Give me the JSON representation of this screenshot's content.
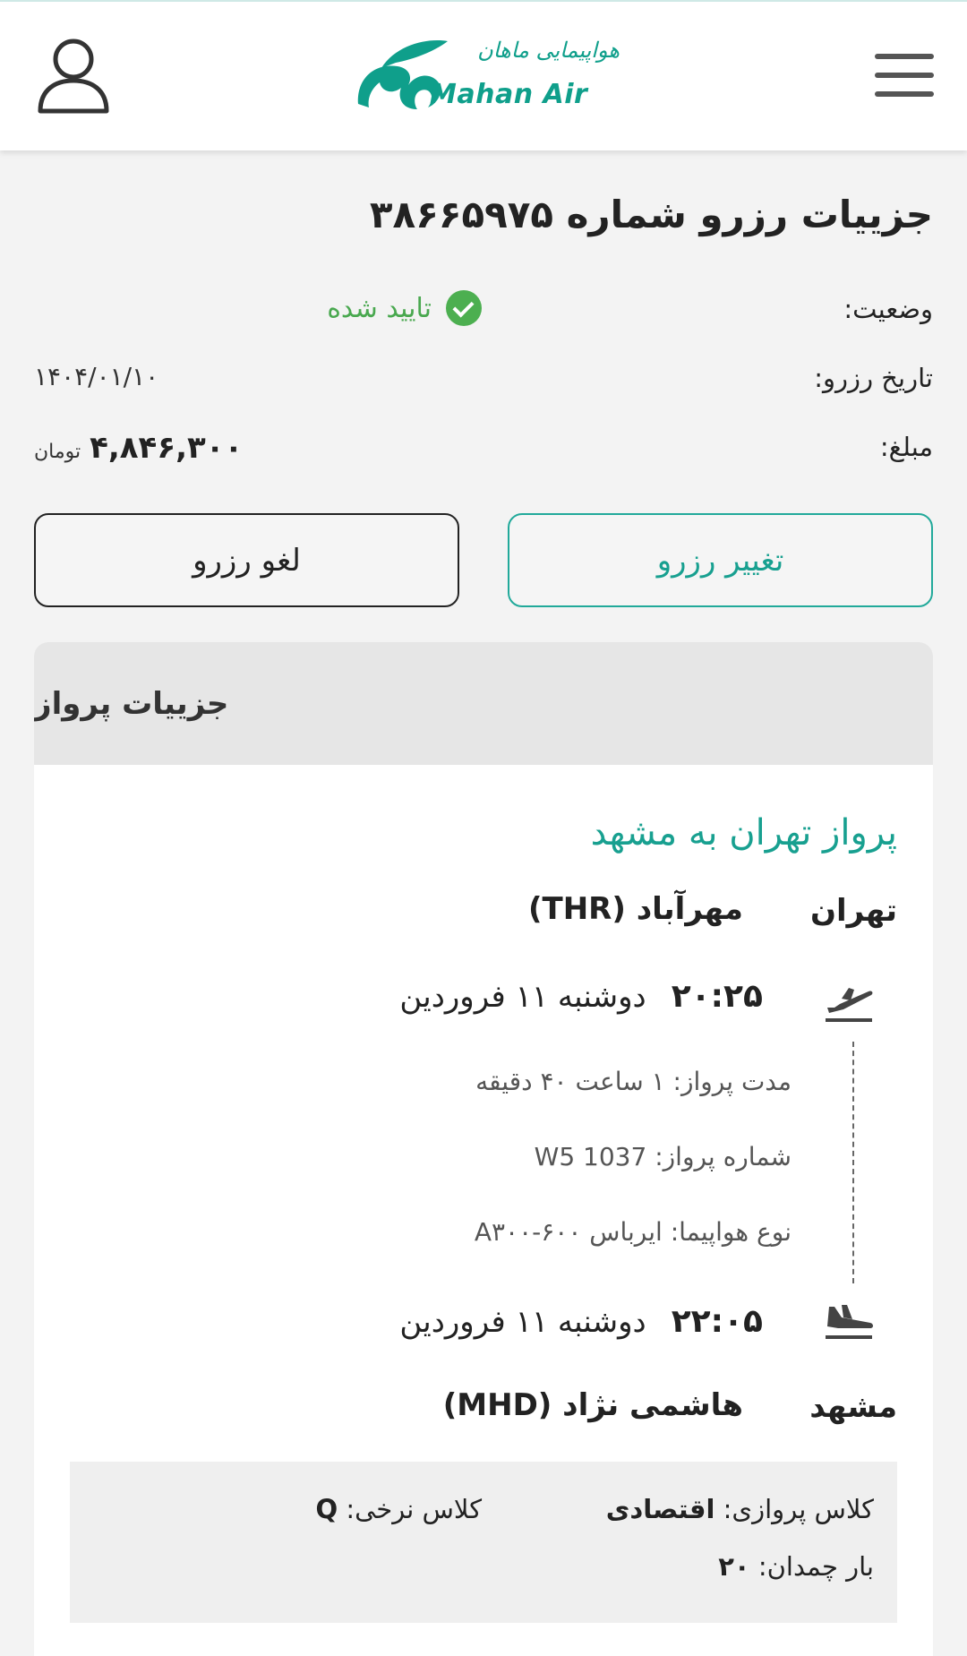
{
  "header": {
    "logo_text": "Mahan Air",
    "logo_text_fa": "هواپیمایی ماهان",
    "menu_icon": "hamburger-menu-icon",
    "user_icon": "user-profile-icon",
    "brand_color": "#0f9f8b"
  },
  "booking": {
    "title": "جزییات رزرو شماره ۳۸۶۶۵۹۷۵",
    "status_label": "وضعیت:",
    "status_value": "تایید شده",
    "status_color": "#49a84f",
    "date_label": "تاریخ رزرو:",
    "date_value": "۱۴۰۴/۰۱/۱۰",
    "amount_label": "مبلغ:",
    "amount_value": "۴,۸۴۶,۳۰۰",
    "amount_currency": "تومان"
  },
  "actions": {
    "change_label": "تغییر رزرو",
    "cancel_label": "لغو رزرو"
  },
  "flight": {
    "section_title": "جزییات پرواز",
    "route_title": "پرواز تهران به مشهد",
    "origin_city": "تهران",
    "origin_airport": "مهرآباد (THR)",
    "departure_time": "۲۰:۲۵",
    "departure_date": "دوشنبه ۱۱ فروردین",
    "duration_label": "مدت پرواز:",
    "duration_value": "۱ ساعت ۴۰ دقیقه",
    "flight_no_label": "شماره پرواز:",
    "flight_no_value": "W5 1037",
    "aircraft_label": "نوع هواپیما:",
    "aircraft_value": "ایرباس ۶۰۰-A۳۰۰",
    "arrival_time": "۲۲:۰۵",
    "arrival_date": "دوشنبه ۱۱ فروردین",
    "dest_city": "مشهد",
    "dest_airport": "هاشمی نژاد (MHD)",
    "cabin_label": "کلاس پروازی:",
    "cabin_value": "اقتصادی",
    "fare_label": "کلاس نرخی:",
    "fare_value": "Q",
    "baggage_label": "بار چمدان:",
    "baggage_value": "۲۰",
    "departure_icon": "plane-takeoff-icon",
    "arrival_icon": "plane-landing-icon"
  }
}
